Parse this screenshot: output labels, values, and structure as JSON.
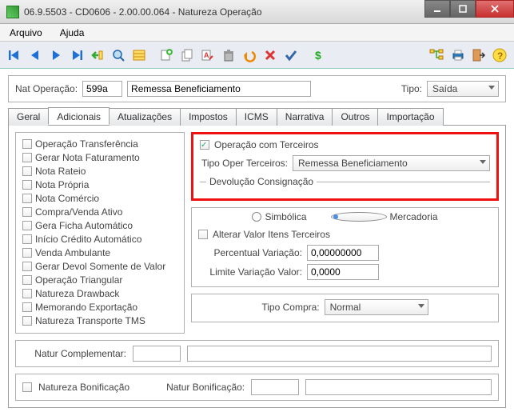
{
  "titlebar": {
    "text": "06.9.5503 - CD0606 - 2.00.00.064 - Natureza Operação"
  },
  "menu": {
    "arquivo": "Arquivo",
    "ajuda": "Ajuda"
  },
  "header": {
    "nat_label": "Nat Operação:",
    "nat_code": "599a",
    "nat_desc": "Remessa Beneficiamento",
    "tipo_label": "Tipo:",
    "tipo_value": "Saída"
  },
  "tabs": {
    "geral": "Geral",
    "adicionais": "Adicionais",
    "atualizacoes": "Atualizações",
    "impostos": "Impostos",
    "icms": "ICMS",
    "narrativa": "Narrativa",
    "outros": "Outros",
    "importacao": "Importação"
  },
  "left_checks": [
    "Operação Transferência",
    "Gerar Nota Faturamento",
    "Nota Rateio",
    "Nota Própria",
    "Nota Comércio",
    "Compra/Venda Ativo",
    "Gera Ficha Automático",
    "Início Crédito Automático",
    "Venda Ambulante",
    "Gerar Devol Somente de Valor",
    "Operação Triangular",
    "Natureza Drawback",
    "Memorando Exportação",
    "Natureza Transporte TMS"
  ],
  "right": {
    "op_terceiros_label": "Operação com Terceiros",
    "tipo_oper_label": "Tipo Oper Terceiros:",
    "tipo_oper_value": "Remessa Beneficiamento",
    "devolucao_legend": "Devolução Consignação",
    "simbolica": "Simbólica",
    "mercadoria": "Mercadoria",
    "alterar_label": "Alterar Valor Itens Terceiros",
    "perc_label": "Percentual Variação:",
    "perc_value": "0,00000000",
    "lim_label": "Limite Variação Valor:",
    "lim_value": "0,0000",
    "tipo_compra_label": "Tipo Compra:",
    "tipo_compra_value": "Normal"
  },
  "bottom": {
    "natur_compl_label": "Natur Complementar:",
    "natur_compl_code": "",
    "natur_compl_desc": "",
    "nat_bonif_chk": "Natureza Bonificação",
    "nat_bonif_label": "Natur Bonificação:",
    "nat_bonif_code": "",
    "nat_bonif_desc": ""
  }
}
